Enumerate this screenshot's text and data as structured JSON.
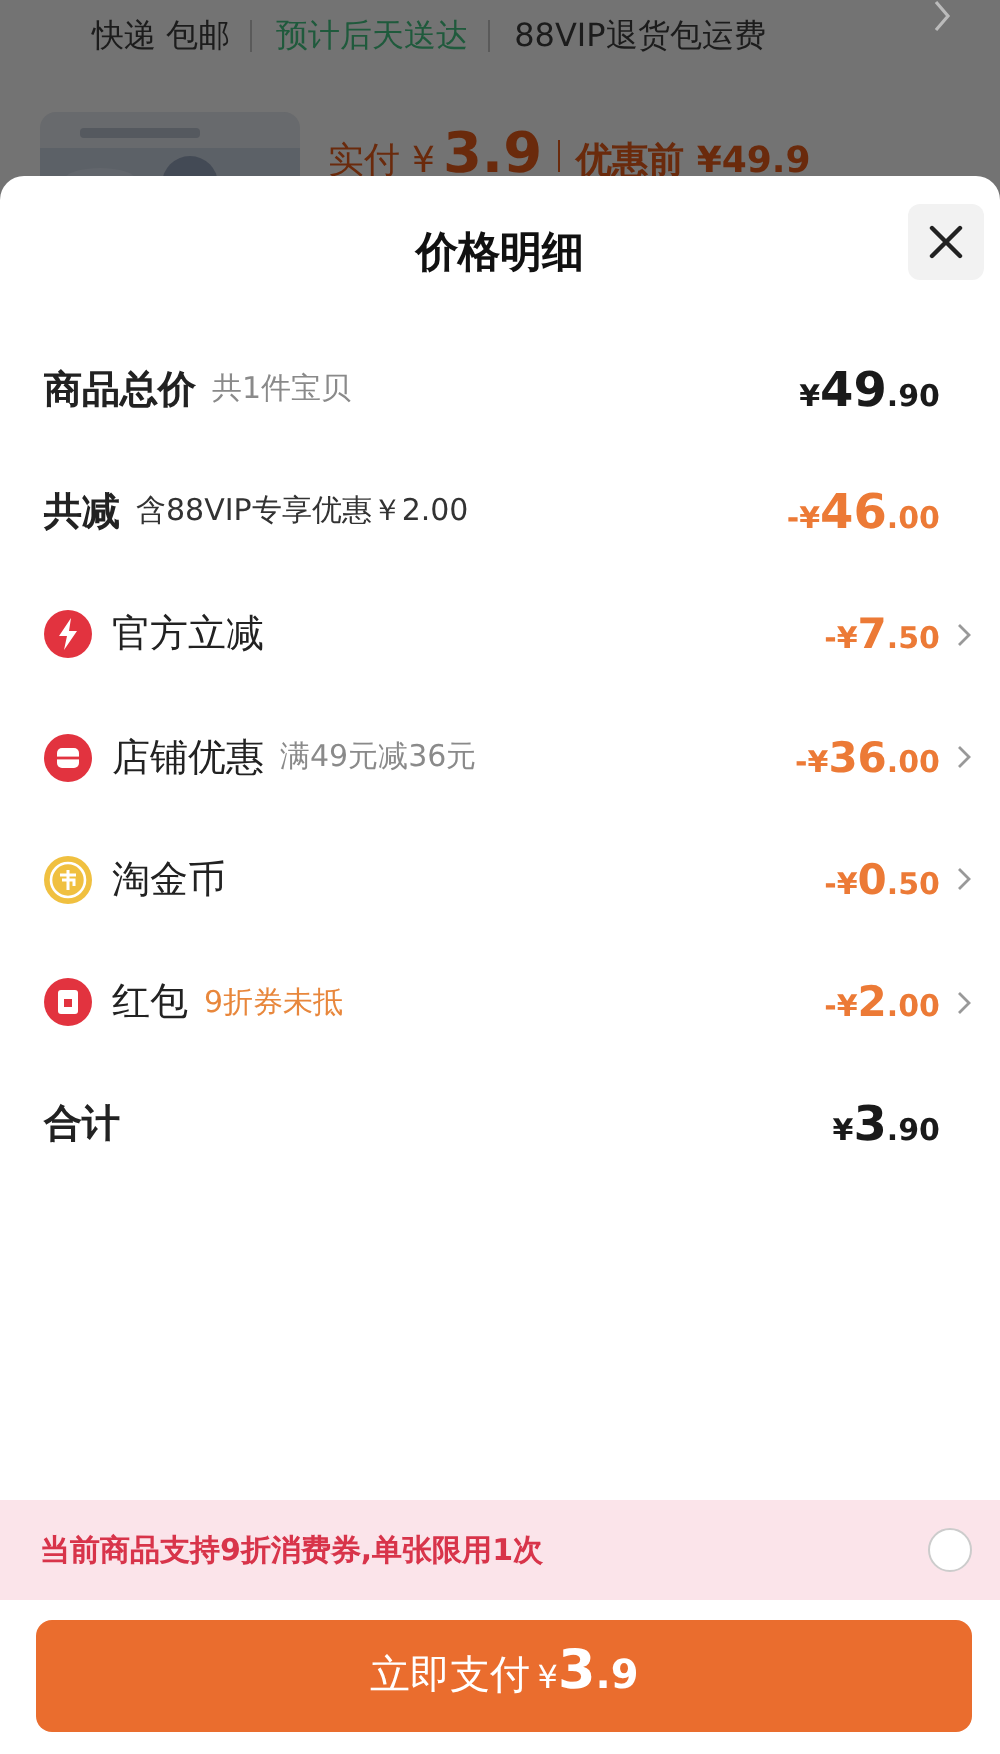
{
  "background_page": {
    "shipping": [
      {
        "text": "快递 包邮",
        "color": "#1c1c1c"
      },
      {
        "text": "预计后天送达",
        "color": "#1f5a3c"
      },
      {
        "text": "88VIP退货包运费",
        "color": "#1c1c1c"
      }
    ],
    "paid_label": "实付",
    "paid_currency": "¥",
    "paid_amount": "3.9",
    "original_price": "优惠前 ¥49.9"
  },
  "sheet": {
    "title": "价格明细",
    "rows": [
      {
        "kind": "total",
        "label": "商品总价",
        "note": {
          "text": "共1件宝贝",
          "color": "#8a8a8a"
        },
        "amount": {
          "currency": "¥",
          "whole": "49",
          "fraction": ".90"
        }
      },
      {
        "kind": "deduction",
        "label": "共减",
        "note": {
          "text": "含88VIP专享优惠￥2.00",
          "color": "#333333"
        },
        "amount": {
          "sign": "-",
          "currency": "¥",
          "whole": "46",
          "fraction": ".00"
        }
      },
      {
        "kind": "discount",
        "label": "官方立减",
        "amount": {
          "sign": "-",
          "currency": "¥",
          "whole": "7",
          "fraction": ".50"
        }
      },
      {
        "kind": "discount",
        "label": "店铺优惠",
        "note": {
          "text": "满49元减36元",
          "color": "#8a8a8a"
        },
        "amount": {
          "sign": "-",
          "currency": "¥",
          "whole": "36",
          "fraction": ".00"
        }
      },
      {
        "kind": "discount",
        "label": "淘金币",
        "amount": {
          "sign": "-",
          "currency": "¥",
          "whole": "0",
          "fraction": ".50"
        }
      },
      {
        "kind": "discount",
        "label": "红包",
        "note": {
          "text": "9折券未抵",
          "color": "#e8873c"
        },
        "amount": {
          "sign": "-",
          "currency": "¥",
          "whole": "2",
          "fraction": ".00"
        }
      },
      {
        "kind": "total",
        "label": "合计",
        "amount": {
          "currency": "¥",
          "whole": "3",
          "fraction": ".90"
        }
      }
    ],
    "coupon_banner": {
      "text": "当前商品支持9折消费券,单张限用1次",
      "checked": false
    },
    "pay_button": {
      "label": "立即支付",
      "currency": "¥",
      "whole": "3",
      "fraction": ".9"
    }
  }
}
